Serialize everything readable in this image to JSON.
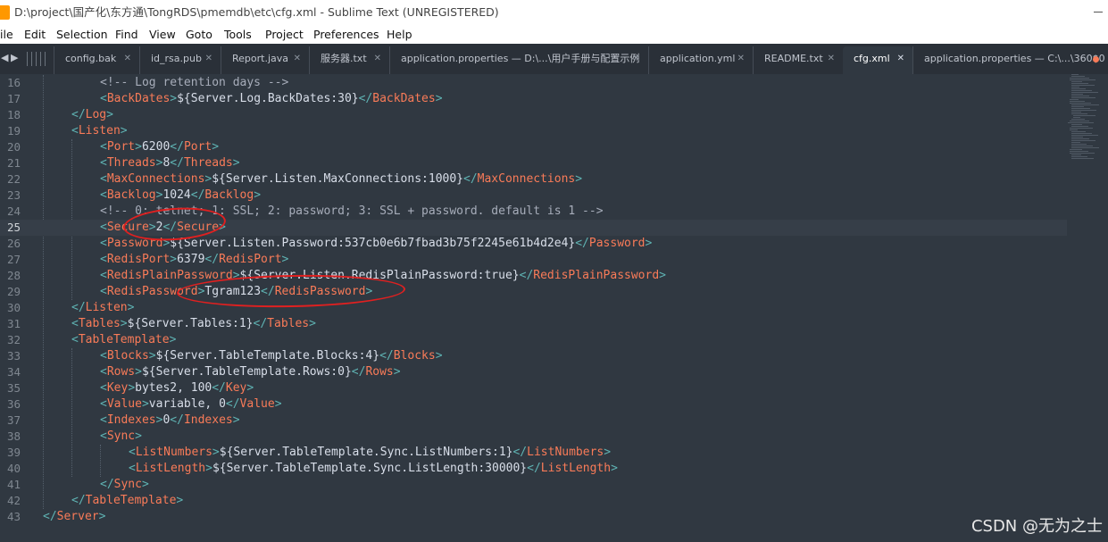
{
  "window": {
    "title": "D:\\project\\国产化\\东方通\\TongRDS\\pmemdb\\etc\\cfg.xml - Sublime Text (UNREGISTERED)"
  },
  "menu": [
    "ile",
    "Edit",
    "Selection",
    "Find",
    "View",
    "Goto",
    "Tools",
    "Project",
    "Preferences",
    "Help"
  ],
  "tabs": [
    {
      "label": "config.bak",
      "active": false
    },
    {
      "label": "id_rsa.pub",
      "active": false
    },
    {
      "label": "Report.java",
      "active": false
    },
    {
      "label": "服务器.txt",
      "active": false
    },
    {
      "label": "application.properties — D:\\...\\用户手册与配置示例",
      "active": false
    },
    {
      "label": "application.yml",
      "active": false
    },
    {
      "label": "README.txt",
      "active": false
    },
    {
      "label": "cfg.xml",
      "active": true
    },
    {
      "label": "application.properties — C:\\...\\360$0",
      "active": false,
      "dirty": true
    }
  ],
  "editor": {
    "current_line": 25,
    "lines": [
      {
        "n": "16",
        "indent": 2,
        "parts": [
          [
            "c",
            "<!-- Log retention days -->"
          ]
        ]
      },
      {
        "n": "17",
        "indent": 2,
        "parts": [
          [
            "p",
            "<"
          ],
          [
            "t",
            "BackDates"
          ],
          [
            "p",
            ">"
          ],
          [
            "x",
            "${Server.Log.BackDates:30}"
          ],
          [
            "p",
            "</"
          ],
          [
            "t",
            "BackDates"
          ],
          [
            "p",
            ">"
          ]
        ]
      },
      {
        "n": "18",
        "indent": 1,
        "parts": [
          [
            "p",
            "</"
          ],
          [
            "t",
            "Log"
          ],
          [
            "p",
            ">"
          ]
        ]
      },
      {
        "n": "19",
        "indent": 1,
        "parts": [
          [
            "p",
            "<"
          ],
          [
            "t",
            "Listen"
          ],
          [
            "p",
            ">"
          ]
        ]
      },
      {
        "n": "20",
        "indent": 2,
        "parts": [
          [
            "p",
            "<"
          ],
          [
            "t",
            "Port"
          ],
          [
            "p",
            ">"
          ],
          [
            "x",
            "6200"
          ],
          [
            "p",
            "</"
          ],
          [
            "t",
            "Port"
          ],
          [
            "p",
            ">"
          ]
        ]
      },
      {
        "n": "21",
        "indent": 2,
        "parts": [
          [
            "p",
            "<"
          ],
          [
            "t",
            "Threads"
          ],
          [
            "p",
            ">"
          ],
          [
            "x",
            "8"
          ],
          [
            "p",
            "</"
          ],
          [
            "t",
            "Threads"
          ],
          [
            "p",
            ">"
          ]
        ]
      },
      {
        "n": "22",
        "indent": 2,
        "parts": [
          [
            "p",
            "<"
          ],
          [
            "t",
            "MaxConnections"
          ],
          [
            "p",
            ">"
          ],
          [
            "x",
            "${Server.Listen.MaxConnections:1000}"
          ],
          [
            "p",
            "</"
          ],
          [
            "t",
            "MaxConnections"
          ],
          [
            "p",
            ">"
          ]
        ]
      },
      {
        "n": "23",
        "indent": 2,
        "parts": [
          [
            "p",
            "<"
          ],
          [
            "t",
            "Backlog"
          ],
          [
            "p",
            ">"
          ],
          [
            "x",
            "1024"
          ],
          [
            "p",
            "</"
          ],
          [
            "t",
            "Backlog"
          ],
          [
            "p",
            ">"
          ]
        ]
      },
      {
        "n": "24",
        "indent": 2,
        "parts": [
          [
            "c",
            "<!-- 0: telnet; 1: SSL; 2: password; 3: SSL + password. default is 1 -->"
          ]
        ]
      },
      {
        "n": "25",
        "indent": 2,
        "parts": [
          [
            "p",
            "<"
          ],
          [
            "t",
            "Secure"
          ],
          [
            "p",
            ">"
          ],
          [
            "x",
            "2"
          ],
          [
            "p",
            "</"
          ],
          [
            "t",
            "Secure"
          ],
          [
            "p",
            ">"
          ]
        ]
      },
      {
        "n": "26",
        "indent": 2,
        "parts": [
          [
            "p",
            "<"
          ],
          [
            "t",
            "Password"
          ],
          [
            "p",
            ">"
          ],
          [
            "x",
            "${Server.Listen.Password:537cb0e6b7fbad3b75f2245e61b4d2e4}"
          ],
          [
            "p",
            "</"
          ],
          [
            "t",
            "Password"
          ],
          [
            "p",
            ">"
          ]
        ]
      },
      {
        "n": "27",
        "indent": 2,
        "parts": [
          [
            "p",
            "<"
          ],
          [
            "t",
            "RedisPort"
          ],
          [
            "p",
            ">"
          ],
          [
            "x",
            "6379"
          ],
          [
            "p",
            "</"
          ],
          [
            "t",
            "RedisPort"
          ],
          [
            "p",
            ">"
          ]
        ]
      },
      {
        "n": "28",
        "indent": 2,
        "parts": [
          [
            "p",
            "<"
          ],
          [
            "t",
            "RedisPlainPassword"
          ],
          [
            "p",
            ">"
          ],
          [
            "x",
            "${Server.Listen.RedisPlainPassword:true}"
          ],
          [
            "p",
            "</"
          ],
          [
            "t",
            "RedisPlainPassword"
          ],
          [
            "p",
            ">"
          ]
        ]
      },
      {
        "n": "29",
        "indent": 2,
        "parts": [
          [
            "p",
            "<"
          ],
          [
            "t",
            "RedisPassword"
          ],
          [
            "p",
            ">"
          ],
          [
            "x",
            "Tgram123"
          ],
          [
            "p",
            "</"
          ],
          [
            "t",
            "RedisPassword"
          ],
          [
            "p",
            ">"
          ]
        ]
      },
      {
        "n": "30",
        "indent": 1,
        "parts": [
          [
            "p",
            "</"
          ],
          [
            "t",
            "Listen"
          ],
          [
            "p",
            ">"
          ]
        ]
      },
      {
        "n": "31",
        "indent": 1,
        "parts": [
          [
            "p",
            "<"
          ],
          [
            "t",
            "Tables"
          ],
          [
            "p",
            ">"
          ],
          [
            "x",
            "${Server.Tables:1}"
          ],
          [
            "p",
            "</"
          ],
          [
            "t",
            "Tables"
          ],
          [
            "p",
            ">"
          ]
        ]
      },
      {
        "n": "32",
        "indent": 1,
        "parts": [
          [
            "p",
            "<"
          ],
          [
            "t",
            "TableTemplate"
          ],
          [
            "p",
            ">"
          ]
        ]
      },
      {
        "n": "33",
        "indent": 2,
        "parts": [
          [
            "p",
            "<"
          ],
          [
            "t",
            "Blocks"
          ],
          [
            "p",
            ">"
          ],
          [
            "x",
            "${Server.TableTemplate.Blocks:4}"
          ],
          [
            "p",
            "</"
          ],
          [
            "t",
            "Blocks"
          ],
          [
            "p",
            ">"
          ]
        ]
      },
      {
        "n": "34",
        "indent": 2,
        "parts": [
          [
            "p",
            "<"
          ],
          [
            "t",
            "Rows"
          ],
          [
            "p",
            ">"
          ],
          [
            "x",
            "${Server.TableTemplate.Rows:0}"
          ],
          [
            "p",
            "</"
          ],
          [
            "t",
            "Rows"
          ],
          [
            "p",
            ">"
          ]
        ]
      },
      {
        "n": "35",
        "indent": 2,
        "parts": [
          [
            "p",
            "<"
          ],
          [
            "t",
            "Key"
          ],
          [
            "p",
            ">"
          ],
          [
            "x",
            "bytes2, 100"
          ],
          [
            "p",
            "</"
          ],
          [
            "t",
            "Key"
          ],
          [
            "p",
            ">"
          ]
        ]
      },
      {
        "n": "36",
        "indent": 2,
        "parts": [
          [
            "p",
            "<"
          ],
          [
            "t",
            "Value"
          ],
          [
            "p",
            ">"
          ],
          [
            "x",
            "variable, 0"
          ],
          [
            "p",
            "</"
          ],
          [
            "t",
            "Value"
          ],
          [
            "p",
            ">"
          ]
        ]
      },
      {
        "n": "37",
        "indent": 2,
        "parts": [
          [
            "p",
            "<"
          ],
          [
            "t",
            "Indexes"
          ],
          [
            "p",
            ">"
          ],
          [
            "x",
            "0"
          ],
          [
            "p",
            "</"
          ],
          [
            "t",
            "Indexes"
          ],
          [
            "p",
            ">"
          ]
        ]
      },
      {
        "n": "38",
        "indent": 2,
        "parts": [
          [
            "p",
            "<"
          ],
          [
            "t",
            "Sync"
          ],
          [
            "p",
            ">"
          ]
        ]
      },
      {
        "n": "39",
        "indent": 3,
        "parts": [
          [
            "p",
            "<"
          ],
          [
            "t",
            "ListNumbers"
          ],
          [
            "p",
            ">"
          ],
          [
            "x",
            "${Server.TableTemplate.Sync.ListNumbers:1}"
          ],
          [
            "p",
            "</"
          ],
          [
            "t",
            "ListNumbers"
          ],
          [
            "p",
            ">"
          ]
        ]
      },
      {
        "n": "40",
        "indent": 3,
        "parts": [
          [
            "p",
            "<"
          ],
          [
            "t",
            "ListLength"
          ],
          [
            "p",
            ">"
          ],
          [
            "x",
            "${Server.TableTemplate.Sync.ListLength:30000}"
          ],
          [
            "p",
            "</"
          ],
          [
            "t",
            "ListLength"
          ],
          [
            "p",
            ">"
          ]
        ]
      },
      {
        "n": "41",
        "indent": 2,
        "parts": [
          [
            "p",
            "</"
          ],
          [
            "t",
            "Sync"
          ],
          [
            "p",
            ">"
          ]
        ]
      },
      {
        "n": "42",
        "indent": 1,
        "parts": [
          [
            "p",
            "</"
          ],
          [
            "t",
            "TableTemplate"
          ],
          [
            "p",
            ">"
          ]
        ]
      },
      {
        "n": "43",
        "indent": 0,
        "parts": [
          [
            "p",
            "</"
          ],
          [
            "t",
            "Server"
          ],
          [
            "p",
            ">"
          ]
        ]
      }
    ]
  },
  "colors": {
    "background": "#303841",
    "tag": "#f97b58",
    "punctuation": "#5fb3b3",
    "comment": "#a7adba",
    "text": "#d8dee9",
    "annotation": "#e02020"
  },
  "watermark": "CSDN @无为之士"
}
